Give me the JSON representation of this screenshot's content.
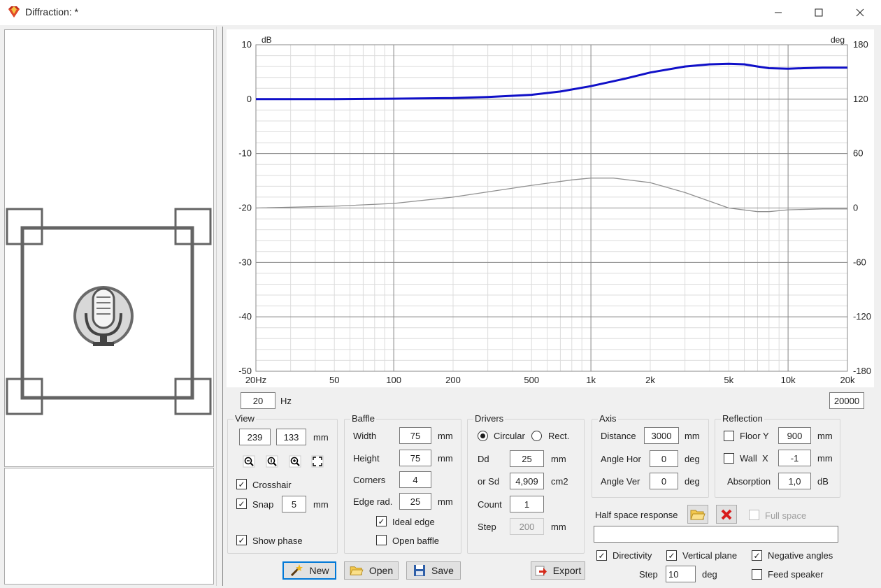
{
  "window": {
    "title": "Diffraction: *",
    "minimize_icon": "minimize-icon",
    "maximize_icon": "maximize-icon",
    "close_icon": "close-icon"
  },
  "chart_data": {
    "type": "line",
    "xscale": "log",
    "xlim": [
      20,
      20000
    ],
    "ylim": [
      -50,
      10
    ],
    "y2lim": [
      -180,
      180
    ],
    "ylabel": "dB",
    "y2label": "deg",
    "x_ticks": [
      20,
      50,
      100,
      200,
      500,
      1000,
      2000,
      5000,
      10000,
      20000
    ],
    "x_tick_labels": [
      "20Hz",
      "50",
      "100",
      "200",
      "500",
      "1k",
      "2k",
      "5k",
      "10k",
      "20k"
    ],
    "y_ticks": [
      10,
      0,
      -10,
      -20,
      -30,
      -40,
      -50
    ],
    "y_tick_labels": [
      "10",
      "0",
      "-10",
      "-20",
      "-30",
      "-40",
      "-50"
    ],
    "y2_ticks": [
      180,
      120,
      60,
      0,
      -60,
      -120,
      -180
    ],
    "y2_tick_labels": [
      "180",
      "120",
      "60",
      "0",
      "-60",
      "-120",
      "-180"
    ],
    "grid": true,
    "series": [
      {
        "axis": "left",
        "color": "#1010c8",
        "x": [
          20,
          50,
          100,
          200,
          300,
          500,
          700,
          1000,
          1500,
          2000,
          3000,
          4000,
          5000,
          6000,
          7000,
          8000,
          10000,
          12000,
          15000,
          20000
        ],
        "y": [
          0.0,
          0.0,
          0.1,
          0.2,
          0.4,
          0.8,
          1.4,
          2.4,
          3.8,
          4.9,
          6.0,
          6.4,
          6.5,
          6.4,
          6.0,
          5.7,
          5.6,
          5.7,
          5.8,
          5.8
        ]
      },
      {
        "axis": "right",
        "color": "#909090",
        "x": [
          20,
          50,
          100,
          200,
          500,
          800,
          1000,
          1300,
          2000,
          3000,
          5000,
          7000,
          8000,
          10000,
          15000,
          20000
        ],
        "y": [
          0,
          2,
          5,
          12,
          25,
          31,
          33,
          33,
          28,
          17,
          0,
          -4,
          -4,
          -2,
          -1,
          -1
        ]
      }
    ]
  },
  "freq": {
    "from": "20",
    "unit": "Hz",
    "to": "20000"
  },
  "view": {
    "title": "View",
    "w": "239",
    "h": "133",
    "unit": "mm",
    "crosshair_label": "Crosshair",
    "crosshair_checked": true,
    "snap_label": "Snap",
    "snap_checked": true,
    "snap_value": "5",
    "snap_unit": "mm",
    "show_phase_label": "Show phase",
    "show_phase_checked": true,
    "tools": [
      "zoom-out-icon",
      "zoom-one-icon",
      "zoom-in-icon",
      "fit-icon"
    ]
  },
  "baffle": {
    "title": "Baffle",
    "width_label": "Width",
    "width": "75",
    "width_unit": "mm",
    "height_label": "Height",
    "height": "75",
    "height_unit": "mm",
    "corners_label": "Corners",
    "corners": "4",
    "edge_label": "Edge rad.",
    "edge": "25",
    "edge_unit": "mm",
    "ideal_edge_label": "Ideal edge",
    "ideal_edge_checked": true,
    "open_baffle_label": "Open baffle",
    "open_baffle_checked": false
  },
  "drivers": {
    "title": "Drivers",
    "circular_label": "Circular",
    "rect_label": "Rect.",
    "selected": "circular",
    "dd_label": "Dd",
    "dd": "25",
    "dd_unit": "mm",
    "sd_label": "or Sd",
    "sd": "4,909",
    "sd_unit": "cm2",
    "count_label": "Count",
    "count": "1",
    "step_label": "Step",
    "step": "200",
    "step_unit": "mm"
  },
  "axis": {
    "title": "Axis",
    "distance_label": "Distance",
    "distance": "3000",
    "distance_unit": "mm",
    "hor_label": "Angle Hor",
    "hor": "0",
    "hor_unit": "deg",
    "ver_label": "Angle Ver",
    "ver": "0",
    "ver_unit": "deg"
  },
  "reflection": {
    "title": "Reflection",
    "floor_label": "Floor Y",
    "floor_checked": false,
    "floor": "900",
    "floor_unit": "mm",
    "wall_label": "Wall  X",
    "wall_checked": false,
    "wall": "-1",
    "wall_unit": "mm",
    "absorption_label": "Absorption",
    "absorption": "1,0",
    "absorption_unit": "dB"
  },
  "halfspace": {
    "label": "Half space response",
    "full_space_label": "Full space",
    "path": ""
  },
  "bottom": {
    "directivity_label": "Directivity",
    "directivity_checked": true,
    "vplane_label": "Vertical plane",
    "vplane_checked": true,
    "neg_label": "Negative angles",
    "neg_checked": true,
    "step_label": "Step",
    "step": "10",
    "step_unit": "deg",
    "feed_label": "Feed speaker",
    "feed_checked": false
  },
  "buttons": {
    "new": "New",
    "open": "Open",
    "save": "Save",
    "export": "Export"
  }
}
